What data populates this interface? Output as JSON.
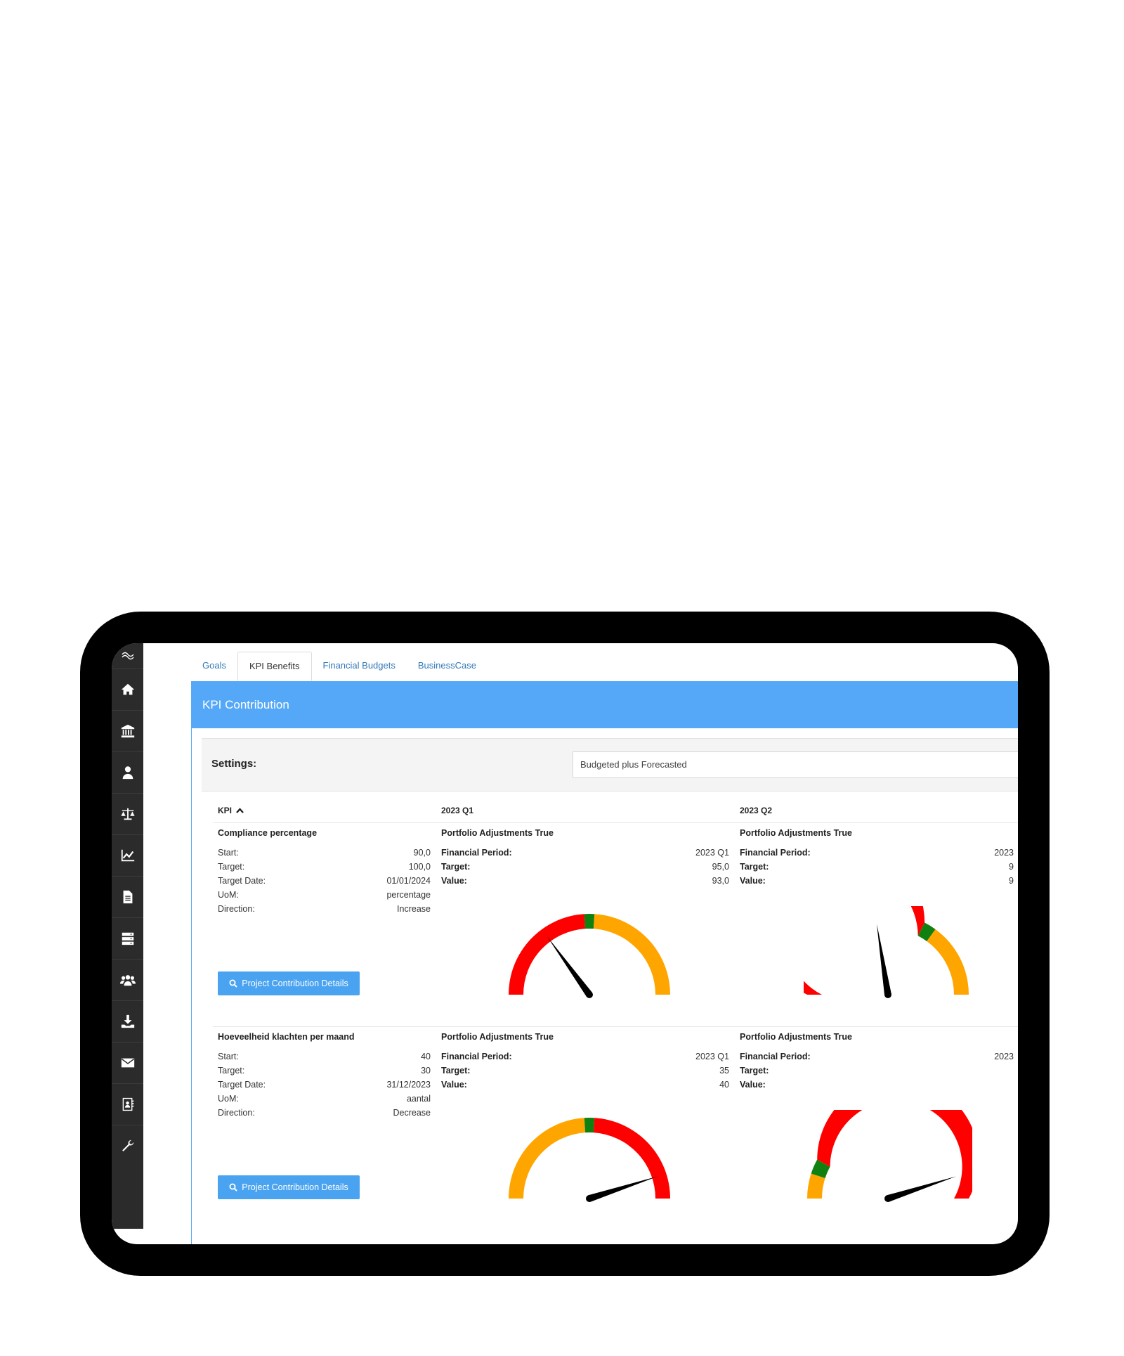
{
  "tabs": [
    "Goals",
    "KPI Benefits",
    "Financial Budgets",
    "BusinessCase"
  ],
  "active_tab": 1,
  "panel_title": "KPI Contribution",
  "settings": {
    "label": "Settings:",
    "selected": "Budgeted plus Forecasted"
  },
  "columns": {
    "kpi": "KPI",
    "q1": "2023 Q1",
    "q2": "2023 Q2"
  },
  "sidebar_icons": [
    "logo-icon",
    "home-icon",
    "bank-icon",
    "user-icon",
    "balance-scale-icon",
    "line-chart-icon",
    "document-icon",
    "server-icon",
    "users-icon",
    "download-icon",
    "envelope-icon",
    "contact-card-icon",
    "wrench-icon"
  ],
  "button_label": "Project Contribution Details",
  "labels": {
    "start": "Start:",
    "target": "Target:",
    "target_date": "Target Date:",
    "uom": "UoM:",
    "direction": "Direction:",
    "fin_period": "Financial Period:",
    "fin_target": "Target:",
    "fin_value": "Value:"
  },
  "colors": {
    "red": "#ff0000",
    "orange": "#ffa500",
    "green": "#108010",
    "header_blue": "#55a8f8",
    "button_blue": "#4aa3f0"
  },
  "kpis": [
    {
      "name": "Compliance percentage",
      "start": "90,0",
      "target": "100,0",
      "target_date": "01/01/2024",
      "uom": "percentage",
      "direction": "Increase",
      "periods": [
        {
          "title": "Portfolio Adjustments True",
          "fin_period": "2023 Q1",
          "target": "95,0",
          "value": "93,0",
          "gauge": {
            "min": 90,
            "max": 100,
            "value": 93,
            "target": 95,
            "zones": [
              [
                "red",
                0,
                0.48
              ],
              [
                "green",
                0.48,
                0.52
              ],
              [
                "orange",
                0.52,
                1
              ]
            ]
          }
        },
        {
          "title": "Portfolio Adjustments True",
          "fin_period": "2023",
          "target": "9",
          "value": "9",
          "gauge": {
            "min": 90,
            "max": 100,
            "value": 94.5,
            "target": 97,
            "zones": [
              [
                "red",
                0,
                0.65
              ],
              [
                "green",
                0.65,
                0.7
              ],
              [
                "orange",
                0.7,
                1
              ]
            ]
          }
        }
      ]
    },
    {
      "name": "Hoeveelheid klachten per maand",
      "start": "40",
      "target": "30",
      "target_date": "31/12/2023",
      "uom": "aantal",
      "direction": "Decrease",
      "periods": [
        {
          "title": "Portfolio Adjustments True",
          "fin_period": "2023 Q1",
          "target": "35",
          "value": "40",
          "gauge": {
            "min": 0,
            "max": 1,
            "value": 0.9,
            "target": 0.5,
            "zones": [
              [
                "orange",
                0,
                0.48
              ],
              [
                "green",
                0.48,
                0.52
              ],
              [
                "red",
                0.52,
                1
              ]
            ]
          }
        },
        {
          "title": "Portfolio Adjustments True",
          "fin_period": "2023",
          "target": "",
          "value": "",
          "gauge": {
            "min": 0,
            "max": 1,
            "value": 0.9,
            "target": 0.1,
            "zones": [
              [
                "orange",
                0,
                0.1
              ],
              [
                "green",
                0.1,
                0.16
              ],
              [
                "red",
                0.16,
                1
              ]
            ]
          }
        }
      ]
    }
  ]
}
